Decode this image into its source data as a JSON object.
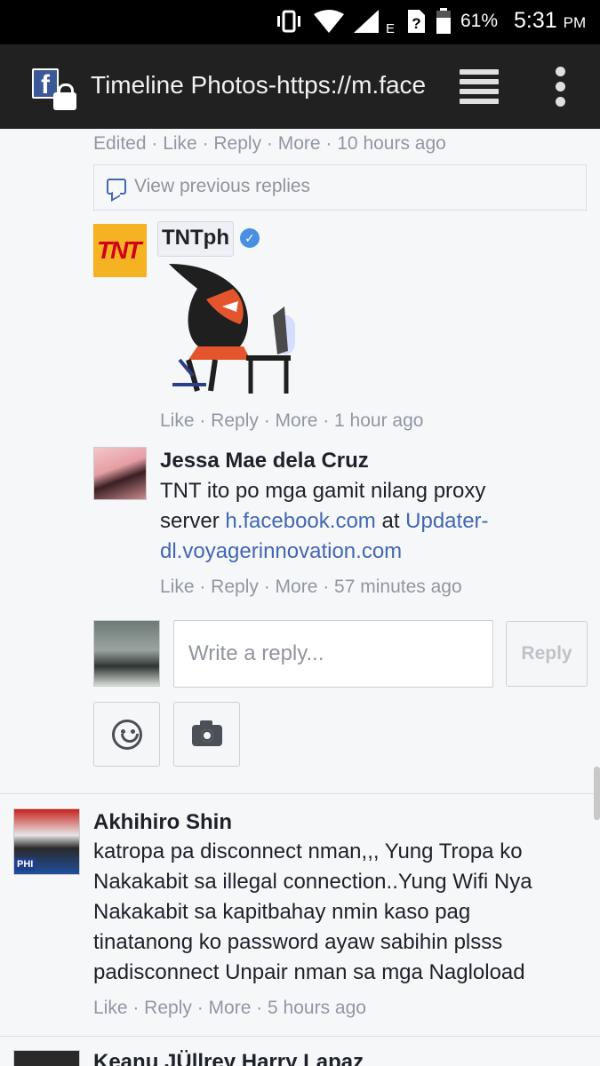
{
  "status_bar": {
    "battery_percent": "61%",
    "time": "5:31",
    "ampm": "PM",
    "network_type": "E"
  },
  "browser": {
    "tab_title": "Timeline Photos-https://m.face"
  },
  "thread": {
    "top_meta": "Edited · Like · Reply · More · 10 hours ago",
    "view_previous": "View previous replies",
    "tnt": {
      "name": "TNTph",
      "logo_text": "TNT",
      "meta": "Like · Reply · More · 1 hour ago"
    },
    "jessa": {
      "name": "Jessa Mae dela Cruz",
      "text_1": "TNT ito po mga gamit nilang proxy",
      "text_2": "server ",
      "link_1": "h.facebook.com",
      "text_3": " at ",
      "link_2a": "Updater-",
      "link_2b": "dl.voyagerinnovation.com",
      "meta": "Like · Reply · More · 57 minutes ago"
    },
    "reply_box": {
      "placeholder": "Write a reply...",
      "button_label": "Reply"
    }
  },
  "akhihiro": {
    "name": "Akhihiro Shin",
    "badge": "PHI",
    "lines": [
      "katropa pa disconnect nman,,, Yung Tropa ko",
      "Nakakabit sa illegal connection..Yung Wifi Nya",
      "Nakakabit sa kapitbahay nmin kaso pag",
      "tinatanong ko password ayaw sabihin plsss",
      "padisconnect Unpair nman sa mga Nagloload"
    ],
    "meta": "Like · Reply · More · 5 hours ago"
  },
  "keanu": {
    "name": "Keanu JÜllrey Harry Lapaz"
  }
}
